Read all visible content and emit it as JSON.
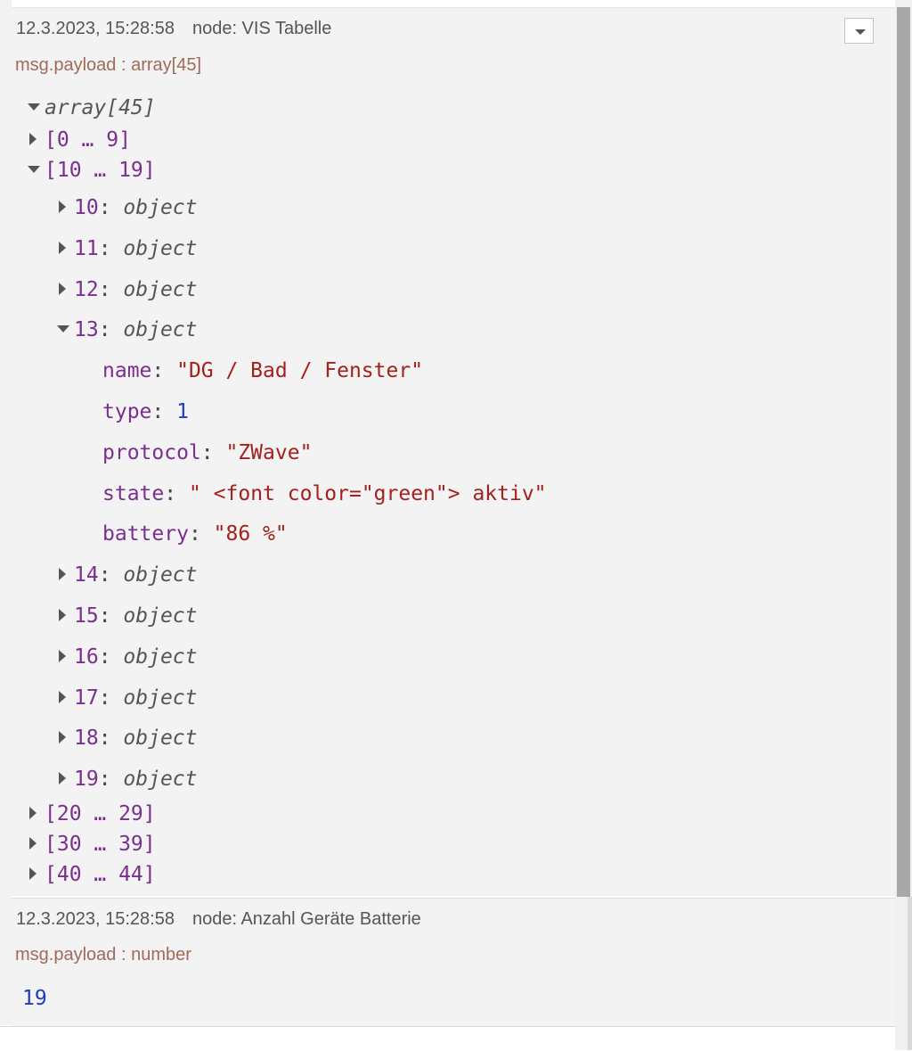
{
  "messages": [
    {
      "timestamp": "12.3.2023, 15:28:58",
      "node": "node: VIS Tabelle",
      "topic": "msg.payload : array[45]",
      "root_label": "array[45]",
      "groups": {
        "g0": "[0 … 9]",
        "g1": "[10 … 19]",
        "g2": "[20 … 29]",
        "g3": "[30 … 39]",
        "g4": "[40 … 44]"
      },
      "items": [
        {
          "key": "10",
          "type": "object"
        },
        {
          "key": "11",
          "type": "object"
        },
        {
          "key": "12",
          "type": "object"
        },
        {
          "key": "13",
          "type": "object"
        },
        {
          "key": "14",
          "type": "object"
        },
        {
          "key": "15",
          "type": "object"
        },
        {
          "key": "16",
          "type": "object"
        },
        {
          "key": "17",
          "type": "object"
        },
        {
          "key": "18",
          "type": "object"
        },
        {
          "key": "19",
          "type": "object"
        }
      ],
      "expanded_fields": [
        {
          "key": "name",
          "value": "\"DG / Bad / Fenster\""
        },
        {
          "key": "type",
          "value": "1"
        },
        {
          "key": "protocol",
          "value": "\"ZWave\""
        },
        {
          "key": "state",
          "value": "\" <font color=\"green\"> aktiv\""
        },
        {
          "key": "battery",
          "value": "\"86 %\""
        }
      ]
    },
    {
      "timestamp": "12.3.2023, 15:28:58",
      "node": "node: Anzahl Geräte Batterie",
      "topic": "msg.payload : number",
      "value": "19"
    }
  ],
  "icons": {
    "dropdown": "chevron-down-icon",
    "collapsed": "caret-right-icon",
    "expanded": "caret-down-icon"
  },
  "colors": {
    "key": "#7a2f8f",
    "string": "#a3201c",
    "number": "#1f3bbf",
    "topic": "#a06a5a"
  }
}
